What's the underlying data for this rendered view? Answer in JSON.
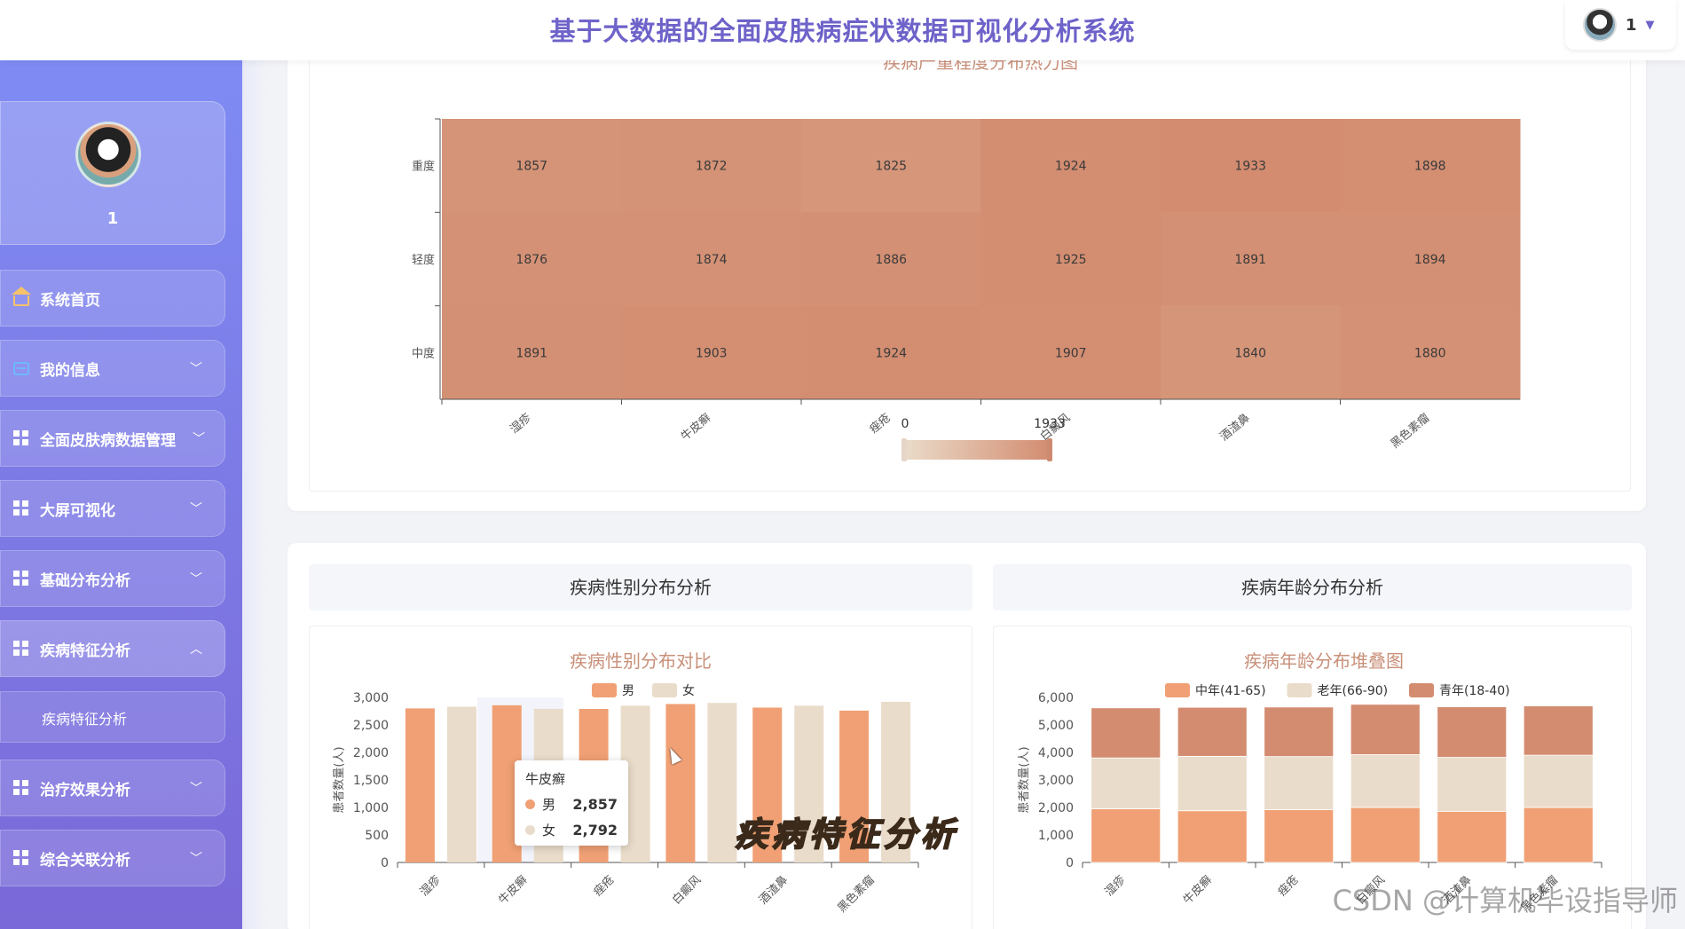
{
  "app_title": "基于大数据的全面皮肤病症状数据可视化分析系统",
  "user": {
    "name": "1"
  },
  "sidebar": {
    "profile_name": "1",
    "items": [
      {
        "label": "系统首页",
        "icon": "home-icon"
      },
      {
        "label": "我的信息",
        "icon": "card-icon"
      },
      {
        "label": "全面皮肤病数据管理",
        "icon": "grid-icon"
      },
      {
        "label": "大屏可视化",
        "icon": "grid-icon"
      },
      {
        "label": "基础分布分析",
        "icon": "grid-icon"
      },
      {
        "label": "疾病特征分析",
        "icon": "grid-icon"
      },
      {
        "label": "治疗效果分析",
        "icon": "grid-icon"
      },
      {
        "label": "综合关联分析",
        "icon": "grid-icon"
      }
    ],
    "submenu_label": "疾病特征分析"
  },
  "sections": {
    "gender_header": "疾病性别分布分析",
    "age_header": "疾病年龄分布分析"
  },
  "tooltip": {
    "title": "牛皮癣",
    "rows": [
      {
        "label": "男",
        "value": "2,857",
        "color": "#f0a074"
      },
      {
        "label": "女",
        "value": "2,792",
        "color": "#eadcca"
      }
    ]
  },
  "overlay_caption": "疾病特征分析",
  "watermark": "CSDN @计算机毕设指导师",
  "chart_data": [
    {
      "type": "heatmap",
      "title": "疾病严重程度分布热力图",
      "x_categories": [
        "湿疹",
        "牛皮癣",
        "痤疮",
        "白癜风",
        "酒渣鼻",
        "黑色素瘤"
      ],
      "y_categories": [
        "重度",
        "轻度",
        "中度"
      ],
      "values": [
        [
          1857,
          1872,
          1825,
          1924,
          1933,
          1898
        ],
        [
          1876,
          1874,
          1886,
          1925,
          1891,
          1894
        ],
        [
          1891,
          1903,
          1924,
          1907,
          1840,
          1880
        ]
      ],
      "visual_map": {
        "min": 0,
        "max": 1933,
        "colors": [
          "#eadcca",
          "#d38c70"
        ]
      }
    },
    {
      "type": "bar",
      "title": "疾病性别分布对比",
      "categories": [
        "湿疹",
        "牛皮癣",
        "痤疮",
        "白癜风",
        "酒渣鼻",
        "黑色素瘤"
      ],
      "ylabel": "患者数量(人)",
      "ylim": [
        0,
        3000
      ],
      "yticks": [
        "0",
        "500",
        "1,000",
        "1,500",
        "2,000",
        "2,500",
        "3,000"
      ],
      "legend_position": "top",
      "series": [
        {
          "name": "男",
          "color": "#f0a074",
          "values": [
            2800,
            2857,
            2790,
            2880,
            2815,
            2760
          ]
        },
        {
          "name": "女",
          "color": "#eadcca",
          "values": [
            2830,
            2792,
            2850,
            2900,
            2850,
            2920
          ]
        }
      ]
    },
    {
      "type": "bar",
      "stacked": true,
      "title": "疾病年龄分布堆叠图",
      "categories": [
        "湿疹",
        "牛皮癣",
        "痤疮",
        "白癜风",
        "酒渣鼻",
        "黑色素瘤"
      ],
      "ylabel": "患者数量(人)",
      "ylim": [
        0,
        6000
      ],
      "yticks": [
        "0",
        "1,000",
        "2,000",
        "3,000",
        "4,000",
        "5,000",
        "6,000"
      ],
      "legend_position": "top",
      "series": [
        {
          "name": "中年(41-65)",
          "color": "#f0a074",
          "values": [
            1950,
            1880,
            1920,
            2000,
            1860,
            2000
          ]
        },
        {
          "name": "老年(66-90)",
          "color": "#eadcca",
          "values": [
            1850,
            1980,
            1930,
            1920,
            1960,
            1900
          ]
        },
        {
          "name": "青年(18-40)",
          "color": "#d38c70",
          "values": [
            1820,
            1780,
            1800,
            1830,
            1840,
            1790
          ]
        }
      ]
    }
  ]
}
